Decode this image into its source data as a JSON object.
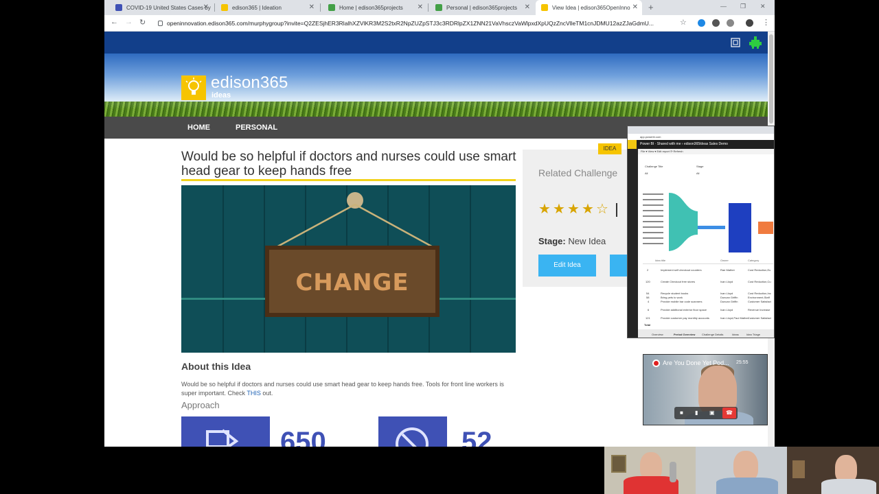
{
  "browser": {
    "tabs": [
      {
        "title": "COVID-19 United States Cases by",
        "icon_color": "#3f51b5"
      },
      {
        "title": "edison365 | Ideation",
        "icon_color": "#f6c400"
      },
      {
        "title": "Home | edison365projects",
        "icon_color": "#43a047"
      },
      {
        "title": "Personal | edison365projects",
        "icon_color": "#43a047"
      },
      {
        "title": "View Idea | edison365OpenInno",
        "icon_color": "#f6c400"
      }
    ],
    "active_tab_index": 4,
    "url": "openinnovation.edison365.com/murphygroup?invite=Q2ZESjhER3RlalhXZVlKR3M2S2txR2NpZUZpSTJ3c3RDRlpZX1ZNN21VaVhsczVaWlpxdXpUQzZncVlleTM1cnJDMU12azZJaGdmU..."
  },
  "site": {
    "logo_text": "edison365",
    "logo_sub": "ideas",
    "menu": [
      "HOME",
      "PERSONAL"
    ],
    "accent": "#f6c400",
    "top_strip_color": "#123f8a"
  },
  "idea": {
    "title": "Would be so helpful if doctors and nurses could use smart head gear to keep hands free",
    "image_text": "CHANGE",
    "about_heading": "About this Idea",
    "about_text": "Would be so helpful if doctors and nurses could use smart head gear to keep hands free.   Tools for front line workers is super important.   Check ",
    "about_link": "THIS",
    "about_tail": " out.",
    "approach_heading": "Approach",
    "approach_numbers": [
      "650",
      "52"
    ]
  },
  "side": {
    "badge": "IDEA",
    "related": "Related Challenge",
    "rating": 4,
    "rating_max": 5,
    "stage_label": "Stage:",
    "stage_value": "New Idea",
    "edit_button": "Edit Idea"
  },
  "powerbi": {
    "app": "Power BI",
    "shared": "Shared with me",
    "report": "edison365Ideas  Sales Demo",
    "filter_label_1": "Challenge Title",
    "filter_label_2": "Stage",
    "filter_value": "All",
    "columns": [
      "Idea title",
      "Owner",
      "Category"
    ],
    "rows": [
      {
        "id": "2",
        "title": "Implement self checkout counters",
        "owner": "Rae Mather",
        "cat": "Cost Reduction,Eu"
      },
      {
        "id": "120",
        "title": "Create Checkout free stores",
        "owner": "Ivan Lloyd",
        "cat": "Cost Reduction,Cu"
      },
      {
        "id": "54",
        "title": "Recycle student books",
        "owner": "Ivan Lloyd",
        "cat": "Cost Reduction,Inc"
      },
      {
        "id": "58",
        "title": "Bring pets to work",
        "owner": "Duncan Griffin",
        "cat": "Environment,Staff"
      },
      {
        "id": "4",
        "title": "Provide mobile bar code scanners",
        "owner": "Duncan Griffin",
        "cat": "Customer Satisfact"
      },
      {
        "id": "6",
        "title": "Provide additional exterior floor space",
        "owner": "Ivan Lloyd",
        "cat": "Revenue Increase"
      },
      {
        "id": "121",
        "title": "Provide customer pay monthly accounts",
        "owner": "Ivan Lloyd,Paul Mather",
        "cat": "Customer Satisfact"
      }
    ],
    "total_label": "Total",
    "bottom_tabs": [
      "Overview",
      "Period Overview",
      "Challenge Details",
      "Ideas",
      "Idea Triage"
    ]
  },
  "video_call": {
    "title": "Are You Done Yet Pod...",
    "time": "25:55"
  }
}
